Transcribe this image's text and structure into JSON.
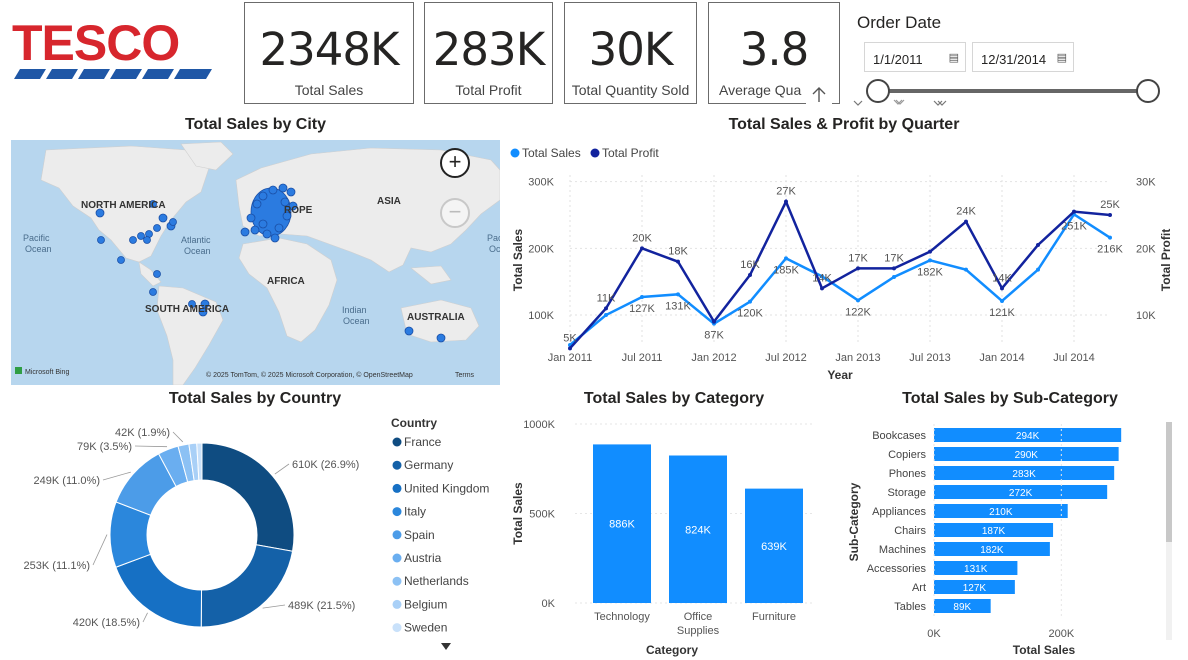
{
  "logo": {
    "text": "TESCO",
    "color": "#d7262d",
    "stripe_color": "#1f57a6"
  },
  "kpis": [
    {
      "value": "2348K",
      "label": "Total Sales"
    },
    {
      "value": "283K",
      "label": "Total Profit"
    },
    {
      "value": "30K",
      "label": "Total Quantity Sold"
    },
    {
      "value": "3.8",
      "label": "Average Qua"
    }
  ],
  "slicer": {
    "title": "Order Date",
    "start": "1/1/2011",
    "end": "12/31/2014",
    "calendar_icon": "calendar-icon"
  },
  "map": {
    "title": "Total Sales by City",
    "labels": [
      "NORTH AMERICA",
      "ASIA",
      "ROPE",
      "AFRICA",
      "SOUTH AMERICA",
      "AUSTRALIA",
      "Pacific",
      "Ocean",
      "Atlantic",
      "Ocean",
      "Indian",
      "Ocean",
      "Pacific",
      "Ocean"
    ],
    "attribution": "© 2025 TomTom, © 2025 Microsoft Corporation, © OpenStreetMap",
    "terms": "Terms",
    "provider": "Microsoft Bing",
    "zoom_in": "+",
    "zoom_out": "−"
  },
  "line_chart_title": "Total Sales & Profit by Quarter",
  "country_title": "Total Sales by Country",
  "category_title": "Total Sales by Category",
  "subcat_title": "Total Sales by Sub-Category",
  "chart_data": [
    {
      "type": "line",
      "title": "Total Sales & Profit by Quarter",
      "xlabel": "Year",
      "ylabel": "Total Sales",
      "y2label": "Total Profit",
      "x": [
        "2011-Q1",
        "2011-Q2",
        "2011-Q3",
        "2011-Q4",
        "2012-Q1",
        "2012-Q2",
        "2012-Q3",
        "2012-Q4",
        "2013-Q1",
        "2013-Q2",
        "2013-Q3",
        "2013-Q4",
        "2014-Q1",
        "2014-Q2",
        "2014-Q3",
        "2014-Q4"
      ],
      "x_ticks": [
        "Jan 2011",
        "Jul 2011",
        "Jan 2012",
        "Jul 2012",
        "Jan 2013",
        "Jul 2013",
        "Jan 2014",
        "Jul 2014"
      ],
      "y_ticks": [
        "100K",
        "200K",
        "300K"
      ],
      "y2_ticks": [
        "10K",
        "20K",
        "30K"
      ],
      "ylim": [
        55000,
        310000
      ],
      "y2lim": [
        5500,
        31000
      ],
      "legend_position": "top-left",
      "series": [
        {
          "name": "Total Sales",
          "axis": "left",
          "color": "#118dff",
          "values": [
            55000,
            100000,
            127000,
            131000,
            87000,
            120000,
            185000,
            158000,
            122000,
            157000,
            182000,
            168000,
            121000,
            168000,
            251000,
            216000
          ],
          "labels": [
            "",
            "",
            "127K",
            "131K",
            "87K",
            "120K",
            "185K",
            "",
            "122K",
            "",
            "182K",
            "",
            "121K",
            "",
            "251K",
            "216K"
          ]
        },
        {
          "name": "Total Profit",
          "axis": "right",
          "color": "#12239e",
          "values": [
            5000,
            11000,
            20000,
            18000,
            9000,
            16000,
            27000,
            14000,
            17000,
            17000,
            19500,
            24000,
            14000,
            20500,
            25500,
            25000
          ],
          "labels": [
            "5K",
            "11K",
            "20K",
            "18K",
            "",
            "16K",
            "27K",
            "14K",
            "17K",
            "17K",
            "",
            "24K",
            "14K",
            "",
            "",
            "25K"
          ]
        }
      ]
    },
    {
      "type": "pie",
      "title": "Total Sales by Country",
      "legend_title": "Country",
      "categories": [
        "France",
        "Germany",
        "United Kingdom",
        "Italy",
        "Spain",
        "Austria",
        "Netherlands",
        "Belgium",
        "Sweden"
      ],
      "values": [
        610,
        489,
        420,
        253,
        249,
        79,
        42,
        30,
        20
      ],
      "labels": [
        "610K (26.9%)",
        "489K (21.5%)",
        "420K (18.5%)",
        "253K (11.1%)",
        "249K (11.0%)",
        "79K (3.5%)",
        "42K (1.9%)",
        "",
        ""
      ],
      "colors": [
        "#0f4c81",
        "#1461a8",
        "#1670c4",
        "#2b87dc",
        "#4c9ce8",
        "#6aaef0",
        "#8cc1f4",
        "#a9d0f7",
        "#c9e1fa"
      ]
    },
    {
      "type": "bar",
      "title": "Total Sales by Category",
      "xlabel": "Category",
      "ylabel": "Total Sales",
      "categories": [
        "Technology",
        "Office Supplies",
        "Furniture"
      ],
      "values": [
        886,
        824,
        639
      ],
      "labels": [
        "886K",
        "824K",
        "639K"
      ],
      "y_ticks": [
        "0K",
        "500K",
        "1000K"
      ],
      "ylim": [
        0,
        1000
      ],
      "color": "#118dff"
    },
    {
      "type": "bar",
      "orientation": "horizontal",
      "title": "Total Sales by Sub-Category",
      "xlabel": "Total Sales",
      "ylabel": "Sub-Category",
      "categories": [
        "Bookcases",
        "Copiers",
        "Phones",
        "Storage",
        "Appliances",
        "Chairs",
        "Machines",
        "Accessories",
        "Art",
        "Tables"
      ],
      "values": [
        294,
        290,
        283,
        272,
        210,
        187,
        182,
        131,
        127,
        89
      ],
      "labels": [
        "294K",
        "290K",
        "283K",
        "272K",
        "210K",
        "187K",
        "182K",
        "131K",
        "127K",
        "89K"
      ],
      "x_ticks": [
        "0K",
        "200K"
      ],
      "xlim": [
        0,
        300
      ],
      "color": "#118dff"
    }
  ]
}
